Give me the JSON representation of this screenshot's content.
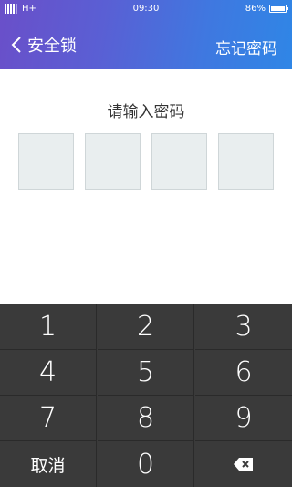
{
  "status_bar": {
    "network": "H+",
    "time": "09:30",
    "battery_percent": "86%",
    "battery_level": 0.86
  },
  "nav": {
    "back_label": "安全锁",
    "forgot_label": "忘记密码"
  },
  "prompt": "请输入密码",
  "code_boxes": 4,
  "keypad": {
    "rows": [
      [
        "1",
        "2",
        "3"
      ],
      [
        "4",
        "5",
        "6"
      ],
      [
        "7",
        "8",
        "9"
      ]
    ],
    "cancel_label": "取消",
    "zero": "0",
    "delete_icon": "backspace-icon"
  },
  "colors": {
    "header_gradient_start": "#6a4fc9",
    "header_gradient_end": "#2f86e6",
    "keypad_bg": "#3a3a3a",
    "code_box_bg": "#e9eeef"
  }
}
